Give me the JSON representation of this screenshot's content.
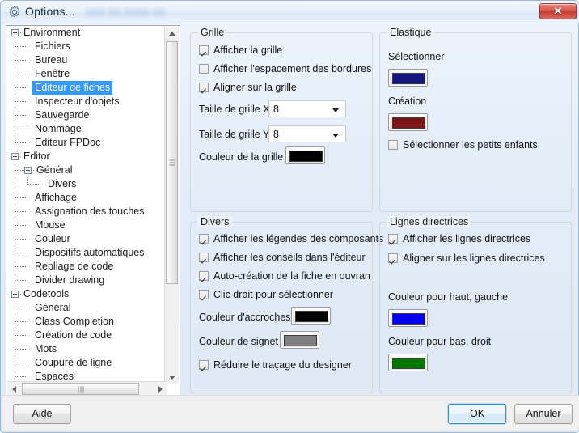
{
  "window": {
    "title": "Options...",
    "blurred_suffix": "XXX XX XXXX XX",
    "close_label": "✕",
    "app_icon": "gear-icon"
  },
  "tree": {
    "items": [
      {
        "label": "Environment",
        "depth": 0,
        "expander": "minus"
      },
      {
        "label": "Fichiers",
        "depth": 1,
        "expander": "none"
      },
      {
        "label": "Bureau",
        "depth": 1,
        "expander": "none"
      },
      {
        "label": "Fenêtre",
        "depth": 1,
        "expander": "none"
      },
      {
        "label": "Editeur de fiches",
        "depth": 1,
        "expander": "none",
        "selected": true
      },
      {
        "label": "Inspecteur d'objets",
        "depth": 1,
        "expander": "none"
      },
      {
        "label": "Sauvegarde",
        "depth": 1,
        "expander": "none"
      },
      {
        "label": "Nommage",
        "depth": 1,
        "expander": "none"
      },
      {
        "label": "Editeur FPDoc",
        "depth": 1,
        "expander": "none",
        "last": true
      },
      {
        "label": "Editor",
        "depth": 0,
        "expander": "minus"
      },
      {
        "label": "Général",
        "depth": 1,
        "expander": "minus"
      },
      {
        "label": "Divers",
        "depth": 2,
        "expander": "none",
        "last": true
      },
      {
        "label": "Affichage",
        "depth": 1,
        "expander": "none"
      },
      {
        "label": "Assignation des touches",
        "depth": 1,
        "expander": "none"
      },
      {
        "label": "Mouse",
        "depth": 1,
        "expander": "none"
      },
      {
        "label": "Couleur",
        "depth": 1,
        "expander": "none"
      },
      {
        "label": "Dispositifs automatiques",
        "depth": 1,
        "expander": "none"
      },
      {
        "label": "Repliage de code",
        "depth": 1,
        "expander": "none"
      },
      {
        "label": "Divider drawing",
        "depth": 1,
        "expander": "none",
        "last": true
      },
      {
        "label": "Codetools",
        "depth": 0,
        "expander": "minus"
      },
      {
        "label": "Général",
        "depth": 1,
        "expander": "none"
      },
      {
        "label": "Class Completion",
        "depth": 1,
        "expander": "none"
      },
      {
        "label": "Création de code",
        "depth": 1,
        "expander": "none"
      },
      {
        "label": "Mots",
        "depth": 1,
        "expander": "none"
      },
      {
        "label": "Coupure de ligne",
        "depth": 1,
        "expander": "none"
      },
      {
        "label": "Espaces",
        "depth": 1,
        "expander": "none"
      }
    ]
  },
  "grille": {
    "title": "Grille",
    "show_grid": {
      "label": "Afficher la grille",
      "checked": true
    },
    "show_border_spacing": {
      "label": "Afficher l'espacement des bordures",
      "checked": false
    },
    "snap_to_grid": {
      "label": "Aligner sur la grille",
      "checked": true
    },
    "grid_size_x": {
      "label": "Taille de grille X",
      "value": "8"
    },
    "grid_size_y": {
      "label": "Taille de grille Y",
      "value": "8"
    },
    "grid_color": {
      "label": "Couleur de la grille",
      "color": "#000000"
    }
  },
  "divers": {
    "title": "Divers",
    "show_component_captions": {
      "label": "Afficher les légendes des composants",
      "checked": true
    },
    "show_editor_hints": {
      "label": "Afficher les conseils dans l'éditeur",
      "checked": true
    },
    "auto_create_form": {
      "label": "Auto-création de la fiche en ouvrant l'u",
      "checked": true
    },
    "right_click_select": {
      "label": "Clic droit pour sélectionner",
      "checked": true
    },
    "grab_color": {
      "label": "Couleur d'accroches",
      "color": "#000000"
    },
    "marker_color": {
      "label": "Couleur de signet",
      "color": "#808080"
    },
    "reduce_designer_painting": {
      "label": "Réduire le traçage du designer",
      "checked": true
    }
  },
  "elastique": {
    "title": "Elastique",
    "select_label": "Sélectionner",
    "select_color": "#15157e",
    "creation_label": "Création",
    "creation_color": "#7e1515",
    "select_grandchildren": {
      "label": "Sélectionner les petits enfants",
      "checked": false
    }
  },
  "lignes": {
    "title": "Lignes directrices",
    "show_guidelines": {
      "label": "Afficher les lignes directrices",
      "checked": true
    },
    "snap_to_guidelines": {
      "label": "Aligner sur les lignes directrices",
      "checked": true
    },
    "top_left_label": "Couleur pour haut, gauche",
    "top_left_color": "#0000ee",
    "bottom_right_label": "Couleur pour bas, droit",
    "bottom_right_color": "#007800"
  },
  "footer": {
    "help_label": "Aide",
    "ok_label": "OK",
    "cancel_label": "Annuler"
  },
  "theme": {
    "selection_color": "#3399ff",
    "dialog_bg": "#edf2f9",
    "close_button_color": "#c53a2f"
  }
}
